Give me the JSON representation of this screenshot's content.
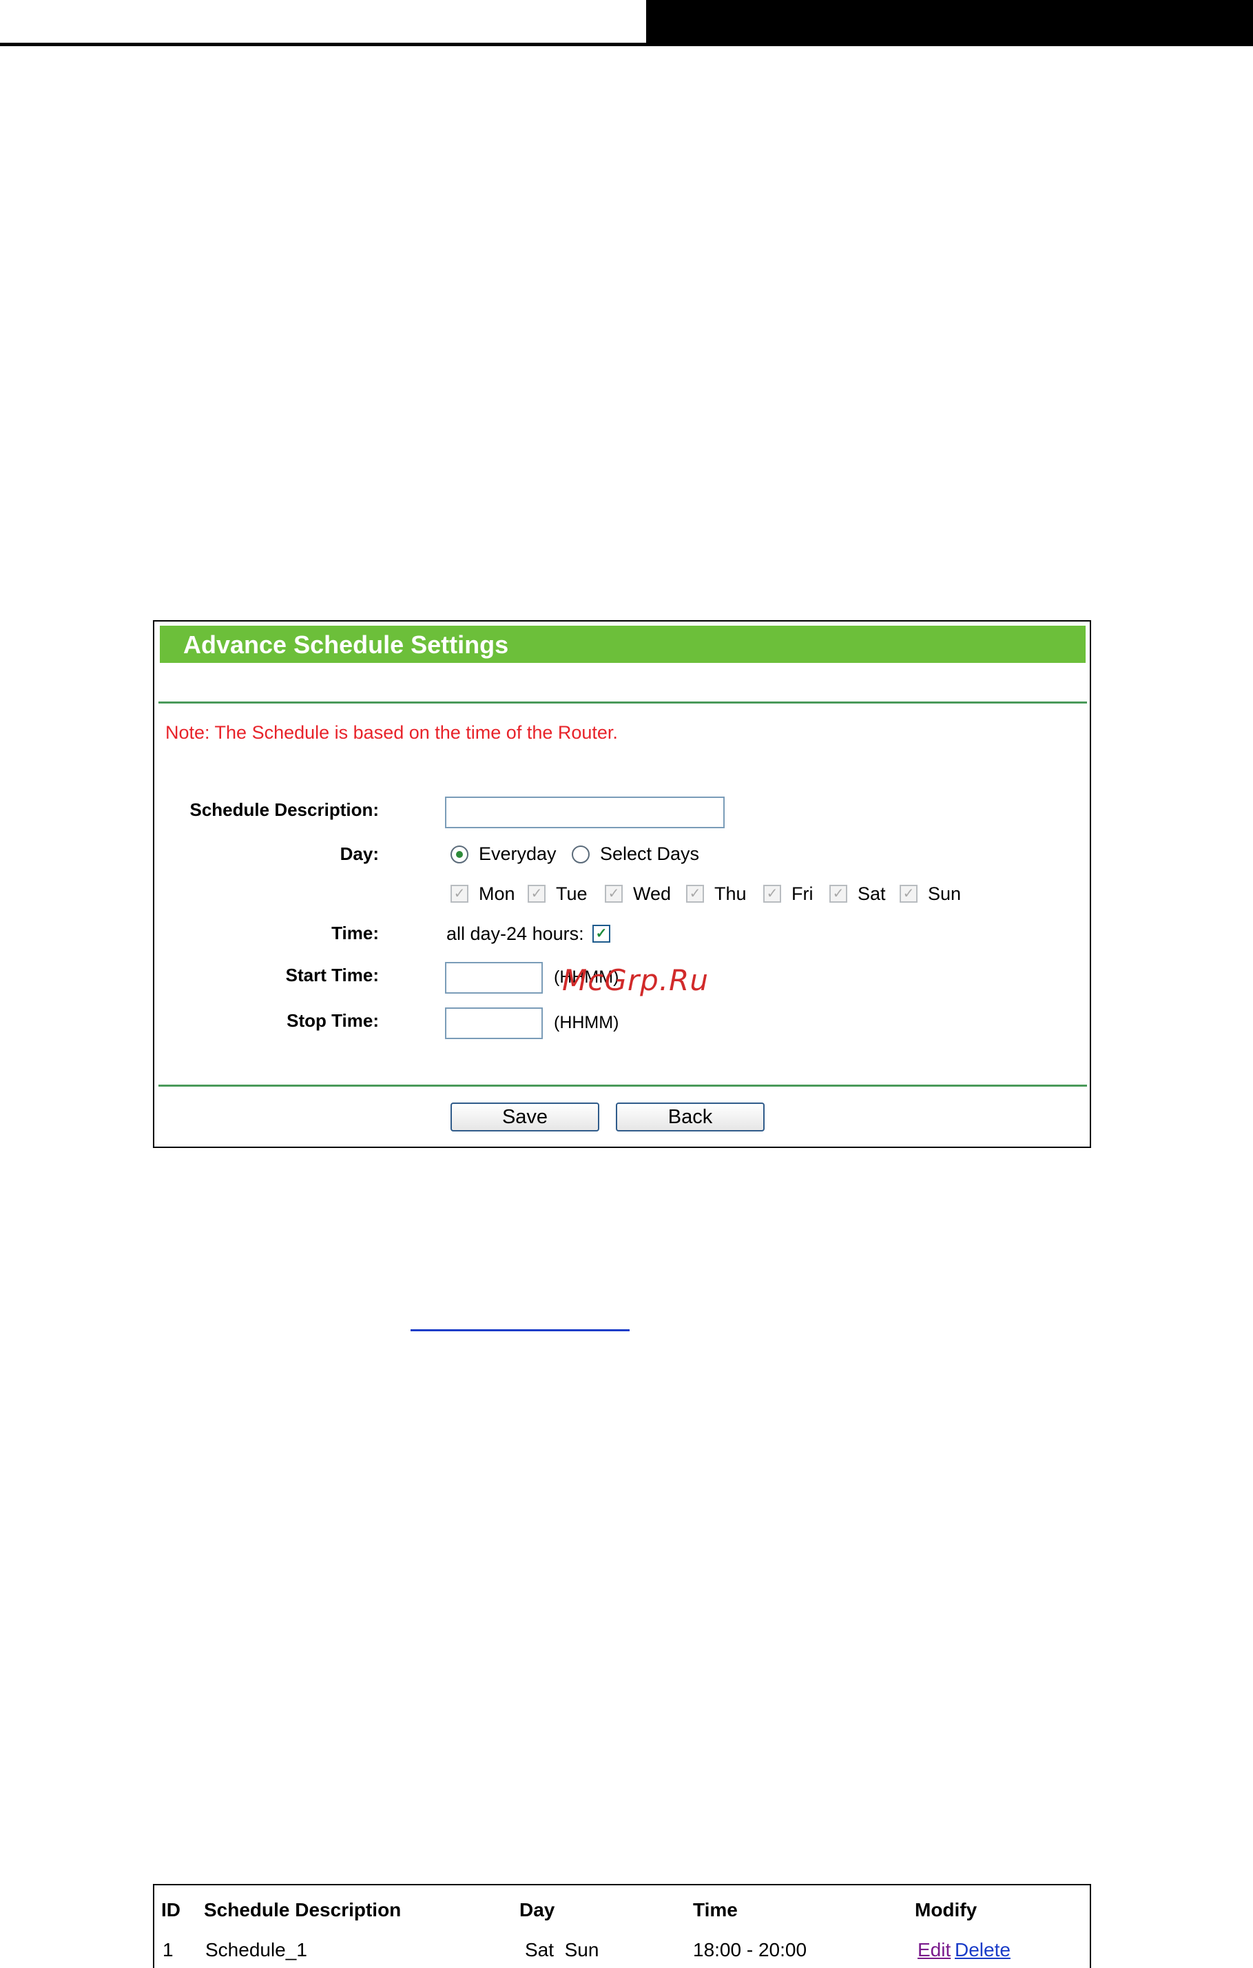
{
  "panel": {
    "title": "Advance Schedule Settings",
    "note": "Note: The Schedule is based on the time of the Router.",
    "labels": {
      "description": "Schedule Description:",
      "day": "Day:",
      "time": "Time:",
      "start": "Start Time:",
      "stop": "Stop Time:"
    },
    "description_value": "",
    "day_options": [
      {
        "label": "Everyday",
        "selected": true
      },
      {
        "label": "Select Days",
        "selected": false
      }
    ],
    "weekdays": [
      "Mon",
      "Tue",
      "Wed",
      "Thu",
      "Fri",
      "Sat",
      "Sun"
    ],
    "allday_label": "all day-24 hours:",
    "allday_checked": true,
    "start_value": "",
    "stop_value": "",
    "time_format": "(HHMM)",
    "buttons": {
      "save": "Save",
      "back": "Back"
    }
  },
  "watermark": "McGrp.Ru",
  "schedule_table": {
    "headers": [
      "ID",
      "Schedule Description",
      "Day",
      "Time",
      "Modify"
    ],
    "rows": [
      {
        "id": "1",
        "description": "Schedule_1",
        "day": "Sat  Sun",
        "time": "18:00 - 20:00",
        "edit": "Edit",
        "delete": "Delete"
      }
    ]
  },
  "colors": {
    "title_bar": "#6cbf3a",
    "note_text": "#e8232a",
    "link_visited": "#7a1a8c",
    "link": "#1a3cc8"
  }
}
